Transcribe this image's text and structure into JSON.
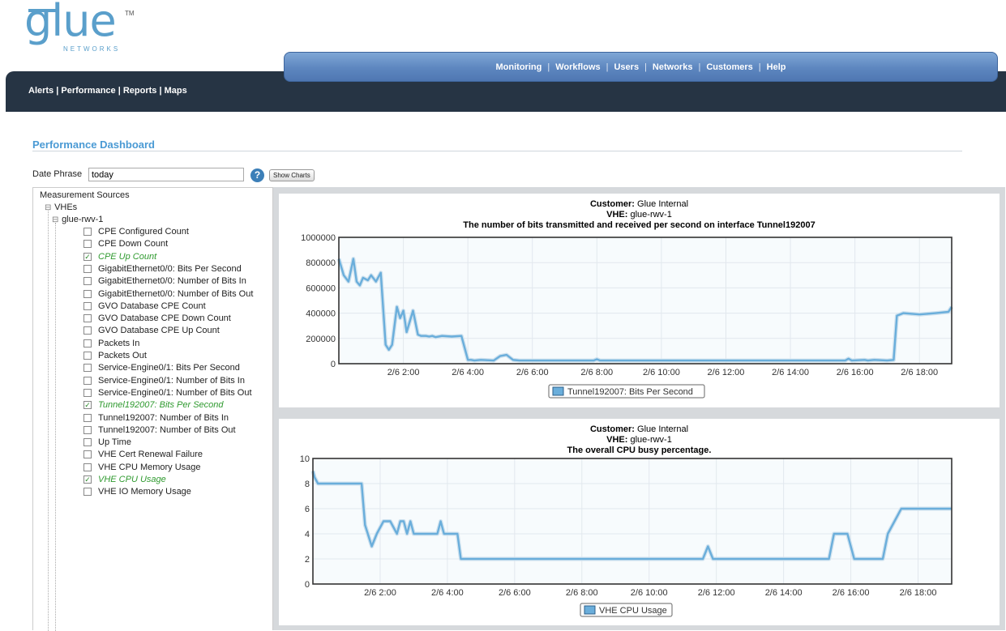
{
  "logo": {
    "word": "glue",
    "sub": "NETWORKS",
    "tm": "TM"
  },
  "topnav": {
    "items": [
      "Monitoring",
      "Workflows",
      "Users",
      "Networks",
      "Customers",
      "Help"
    ]
  },
  "subnav": {
    "items": [
      "Alerts",
      "Performance",
      "Reports",
      "Maps"
    ]
  },
  "page_title": "Performance Dashboard",
  "date_phrase": {
    "label": "Date Phrase",
    "value": "today",
    "help": "?",
    "button": "Show Charts"
  },
  "tree": {
    "root": "Measurement Sources",
    "group": "VHEs",
    "node": "glue-rwv-1",
    "leaves": [
      {
        "label": "CPE Configured Count",
        "checked": false
      },
      {
        "label": "CPE Down Count",
        "checked": false
      },
      {
        "label": "CPE Up Count",
        "checked": true
      },
      {
        "label": "GigabitEthernet0/0: Bits Per Second",
        "checked": false
      },
      {
        "label": "GigabitEthernet0/0: Number of Bits In",
        "checked": false
      },
      {
        "label": "GigabitEthernet0/0: Number of Bits Out",
        "checked": false
      },
      {
        "label": "GVO Database CPE Count",
        "checked": false
      },
      {
        "label": "GVO Database CPE Down Count",
        "checked": false
      },
      {
        "label": "GVO Database CPE Up Count",
        "checked": false
      },
      {
        "label": "Packets In",
        "checked": false
      },
      {
        "label": "Packets Out",
        "checked": false
      },
      {
        "label": "Service-Engine0/1: Bits Per Second",
        "checked": false
      },
      {
        "label": "Service-Engine0/1: Number of Bits In",
        "checked": false
      },
      {
        "label": "Service-Engine0/1: Number of Bits Out",
        "checked": false
      },
      {
        "label": "Tunnel192007: Bits Per Second",
        "checked": true
      },
      {
        "label": "Tunnel192007: Number of Bits In",
        "checked": false
      },
      {
        "label": "Tunnel192007: Number of Bits Out",
        "checked": false
      },
      {
        "label": "Up Time",
        "checked": false
      },
      {
        "label": "VHE Cert Renewal Failure",
        "checked": false
      },
      {
        "label": "VHE CPU Memory Usage",
        "checked": false
      },
      {
        "label": "VHE CPU Usage",
        "checked": true
      },
      {
        "label": "VHE IO Memory Usage",
        "checked": false
      }
    ]
  },
  "colors": {
    "line": "#6aaedb",
    "accent": "#4a9ad4",
    "checked": "#2f9a2f",
    "nav_dark": "#263444"
  },
  "chart_data": [
    {
      "type": "line",
      "customer_label": "Customer:",
      "customer": "Glue Internal",
      "vhe_label": "VHE:",
      "vhe": "glue-rwv-1",
      "title": "The number of bits transmitted and received per second on interface Tunnel192007",
      "ylim": [
        0,
        1000000
      ],
      "yticks": [
        0,
        200000,
        400000,
        600000,
        800000,
        1000000
      ],
      "xlim": [
        0,
        19
      ],
      "xticks": [
        2,
        4,
        6,
        8,
        10,
        12,
        14,
        16,
        18
      ],
      "xtick_labels": [
        "2/6 2:00",
        "2/6 4:00",
        "2/6 6:00",
        "2/6 8:00",
        "2/6 10:00",
        "2/6 12:00",
        "2/6 14:00",
        "2/6 16:00",
        "2/6 18:00"
      ],
      "series": [
        {
          "name": "Tunnel192007: Bits Per Second",
          "x": [
            0,
            0.15,
            0.3,
            0.45,
            0.55,
            0.65,
            0.75,
            0.9,
            1.0,
            1.15,
            1.3,
            1.45,
            1.55,
            1.65,
            1.8,
            1.9,
            2.0,
            2.1,
            2.3,
            2.45,
            2.55,
            2.7,
            2.8,
            2.9,
            3.0,
            3.2,
            3.5,
            3.8,
            4.0,
            4.1,
            4.2,
            4.4,
            4.8,
            5.0,
            5.2,
            5.4,
            5.6,
            6.0,
            7.0,
            7.9,
            8.0,
            8.1,
            9.0,
            10.0,
            11.0,
            12.0,
            13.0,
            14.0,
            15.0,
            15.7,
            15.8,
            15.9,
            16.3,
            16.4,
            16.6,
            17.0,
            17.2,
            17.3,
            17.5,
            18.0,
            18.5,
            18.9,
            19.0
          ],
          "y": [
            830000,
            700000,
            650000,
            830000,
            650000,
            620000,
            680000,
            660000,
            700000,
            650000,
            720000,
            150000,
            110000,
            150000,
            450000,
            360000,
            420000,
            250000,
            420000,
            230000,
            220000,
            220000,
            215000,
            220000,
            210000,
            220000,
            215000,
            220000,
            30000,
            30000,
            25000,
            30000,
            25000,
            60000,
            70000,
            30000,
            25000,
            25000,
            25000,
            25000,
            35000,
            25000,
            25000,
            25000,
            25000,
            25000,
            25000,
            25000,
            25000,
            25000,
            40000,
            25000,
            30000,
            25000,
            30000,
            25000,
            30000,
            380000,
            400000,
            390000,
            400000,
            410000,
            450000
          ]
        }
      ]
    },
    {
      "type": "line",
      "customer_label": "Customer:",
      "customer": "Glue Internal",
      "vhe_label": "VHE:",
      "vhe": "glue-rwv-1",
      "title": "The overall CPU busy percentage.",
      "ylim": [
        0,
        10
      ],
      "yticks": [
        0,
        2,
        4,
        6,
        8,
        10
      ],
      "xlim": [
        0,
        19
      ],
      "xticks": [
        2,
        4,
        6,
        8,
        10,
        12,
        14,
        16,
        18
      ],
      "xtick_labels": [
        "2/6 2:00",
        "2/6 4:00",
        "2/6 6:00",
        "2/6 8:00",
        "2/6 10:00",
        "2/6 12:00",
        "2/6 14:00",
        "2/6 16:00",
        "2/6 18:00"
      ],
      "series": [
        {
          "name": "VHE CPU Usage",
          "x": [
            0,
            0.05,
            0.15,
            1.45,
            1.55,
            1.75,
            1.9,
            2.1,
            2.3,
            2.5,
            2.6,
            2.7,
            2.8,
            2.9,
            3.0,
            3.1,
            3.2,
            3.3,
            3.7,
            3.8,
            3.9,
            4.2,
            4.3,
            4.4,
            6.0,
            8.0,
            10.0,
            11.6,
            11.75,
            11.9,
            14.0,
            15.0,
            15.35,
            15.5,
            15.9,
            16.1,
            16.8,
            16.95,
            17.1,
            17.3,
            17.5,
            18.0,
            19.0
          ],
          "y": [
            9,
            8.5,
            8,
            8,
            4.7,
            3,
            4,
            5,
            5,
            4,
            5,
            5,
            4,
            5,
            4,
            4,
            4,
            4,
            4,
            5,
            4,
            4,
            4,
            2,
            2,
            2,
            2,
            2,
            3,
            2,
            2,
            2,
            2,
            4,
            4,
            2,
            2,
            2,
            4,
            5,
            6,
            6,
            6
          ]
        }
      ]
    }
  ]
}
